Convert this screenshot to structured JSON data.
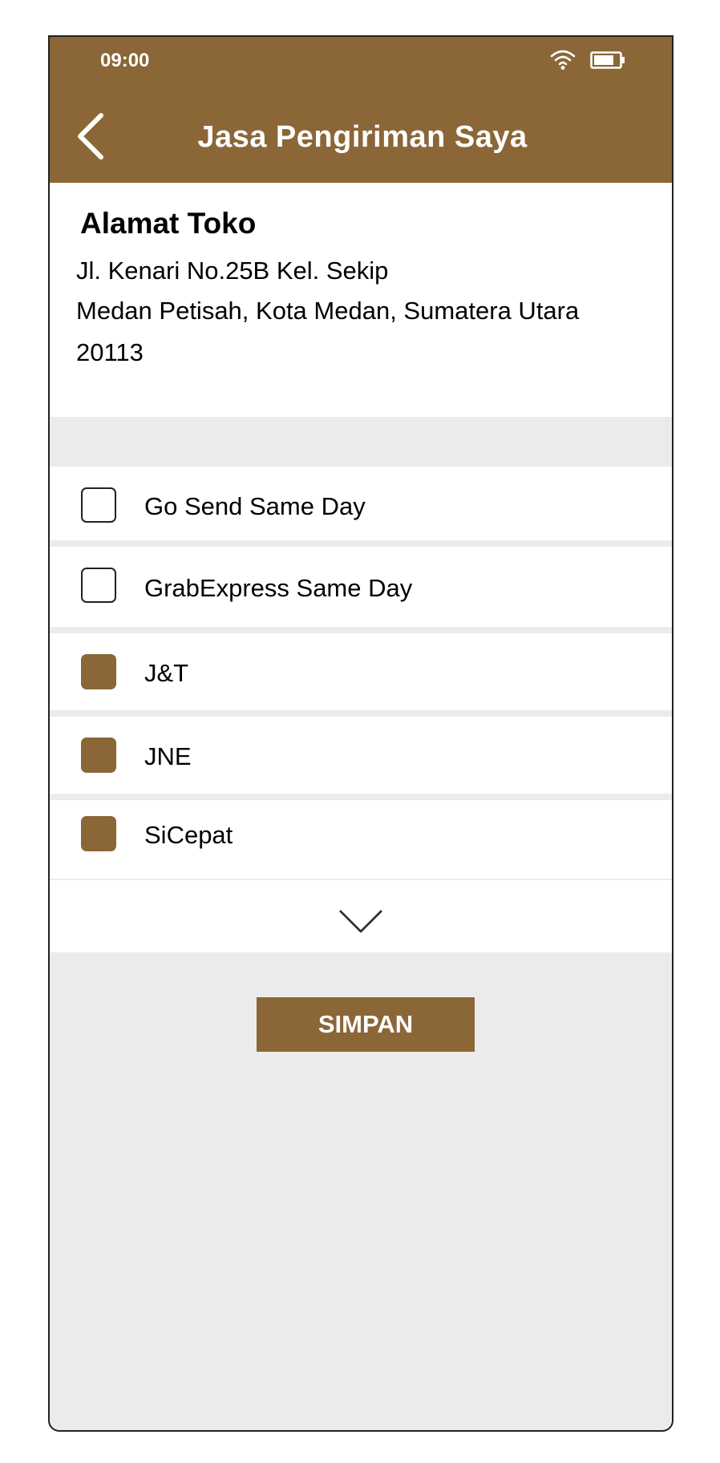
{
  "status_bar": {
    "time": "09:00"
  },
  "header": {
    "title": "Jasa Pengiriman Saya",
    "back_icon": "chevron-left-icon"
  },
  "address": {
    "heading": "Alamat Toko",
    "line1": "Jl. Kenari No.25B Kel. Sekip",
    "line2": "Medan Petisah, Kota Medan, Sumatera Utara",
    "line3": "20113"
  },
  "couriers": [
    {
      "label": "Go Send Same Day",
      "checked": false
    },
    {
      "label": "GrabExpress Same Day",
      "checked": false
    },
    {
      "label": "J&T",
      "checked": true
    },
    {
      "label": "JNE",
      "checked": true
    },
    {
      "label": "SiCepat",
      "checked": true
    }
  ],
  "expand_icon": "chevron-down-icon",
  "actions": {
    "save_label": "SIMPAN"
  },
  "colors": {
    "brand": "#8b6637",
    "background": "#ebebeb",
    "surface": "#ffffff"
  }
}
